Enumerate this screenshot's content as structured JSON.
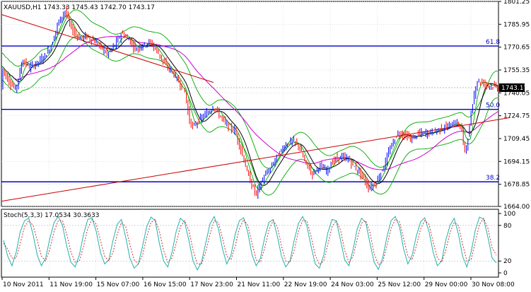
{
  "chart_data": [
    {
      "type": "candlestick",
      "header": "XAUUSD,H1  1743.33 1745.43 1742.70 1743.17",
      "y_ticks": [
        "1801.25",
        "1785.95",
        "1770.65",
        "1755.35",
        "1740.05",
        "1724.75",
        "1709.45",
        "1694.15",
        "1678.85",
        "1664.00"
      ],
      "ylim": [
        1664.0,
        1801.25
      ],
      "current_price": "1743.17",
      "colors": {
        "bull": "#0000ff",
        "bear": "#ff0000",
        "fib_line": "#0000cc",
        "trendline": "#cc0000",
        "bands": "#00aa00",
        "ma_slow": "#cc00cc",
        "ma_fast": "#000000",
        "grid": "#c8d0d8"
      },
      "fib_levels": [
        {
          "label": "61.8",
          "value": 1771.4
        },
        {
          "label": "50.0",
          "value": 1729.0
        },
        {
          "label": "38.2",
          "value": 1680.5
        }
      ],
      "trend_channel": {
        "upper": [
          [
            0,
            1792.5
          ],
          [
            300,
            1747.0
          ]
        ],
        "lower": [
          [
            0,
            1667.5
          ],
          [
            720,
            1723.5
          ]
        ]
      },
      "price_path": [
        [
          0,
          1758
        ],
        [
          10,
          1748
        ],
        [
          20,
          1742
        ],
        [
          30,
          1762
        ],
        [
          40,
          1757
        ],
        [
          50,
          1760
        ],
        [
          60,
          1764
        ],
        [
          70,
          1771
        ],
        [
          80,
          1787
        ],
        [
          90,
          1795
        ],
        [
          100,
          1782
        ],
        [
          110,
          1777
        ],
        [
          120,
          1778
        ],
        [
          130,
          1775
        ],
        [
          140,
          1771
        ],
        [
          150,
          1766
        ],
        [
          160,
          1772
        ],
        [
          170,
          1780
        ],
        [
          180,
          1776
        ],
        [
          190,
          1769
        ],
        [
          200,
          1772
        ],
        [
          210,
          1774
        ],
        [
          220,
          1768
        ],
        [
          230,
          1760
        ],
        [
          240,
          1755
        ],
        [
          250,
          1748
        ],
        [
          260,
          1740
        ],
        [
          265,
          1723
        ],
        [
          270,
          1717
        ],
        [
          280,
          1722
        ],
        [
          290,
          1726
        ],
        [
          300,
          1731
        ],
        [
          310,
          1724
        ],
        [
          320,
          1718
        ],
        [
          330,
          1715
        ],
        [
          340,
          1700
        ],
        [
          350,
          1683
        ],
        [
          360,
          1672
        ],
        [
          370,
          1683
        ],
        [
          380,
          1689
        ],
        [
          390,
          1698
        ],
        [
          400,
          1704
        ],
        [
          410,
          1708
        ],
        [
          420,
          1705
        ],
        [
          430,
          1693
        ],
        [
          440,
          1686
        ],
        [
          450,
          1691
        ],
        [
          460,
          1688
        ],
        [
          470,
          1695
        ],
        [
          480,
          1697
        ],
        [
          490,
          1696
        ],
        [
          500,
          1690
        ],
        [
          510,
          1685
        ],
        [
          520,
          1676
        ],
        [
          530,
          1680
        ],
        [
          540,
          1690
        ],
        [
          550,
          1703
        ],
        [
          560,
          1713
        ],
        [
          570,
          1712
        ],
        [
          580,
          1709
        ],
        [
          590,
          1713
        ],
        [
          600,
          1713
        ],
        [
          610,
          1714
        ],
        [
          620,
          1716
        ],
        [
          630,
          1717
        ],
        [
          640,
          1720
        ],
        [
          650,
          1718
        ],
        [
          655,
          1700
        ],
        [
          660,
          1710
        ],
        [
          665,
          1729
        ],
        [
          672,
          1748
        ],
        [
          680,
          1747
        ],
        [
          690,
          1745
        ],
        [
          700,
          1744
        ],
        [
          704,
          1743
        ]
      ]
    },
    {
      "type": "line",
      "header": "Stoch(5,3,3) 17.0534 30.3633",
      "y_ticks": [
        "100",
        "80",
        "20",
        "0"
      ],
      "ylim": [
        0,
        100
      ],
      "colors": {
        "main": "#20b2aa",
        "signal": "#cc3333"
      },
      "series": [
        {
          "values": [
            55,
            28,
            12,
            35,
            70,
            88,
            92,
            65,
            30,
            12,
            25,
            58,
            85,
            95,
            80,
            45,
            18,
            10,
            30,
            65,
            90,
            93,
            70,
            35,
            15,
            22,
            55,
            82,
            90,
            60,
            25,
            8,
            15,
            45,
            78,
            94,
            88,
            50,
            20,
            10,
            35,
            70,
            92,
            85,
            55,
            20,
            5,
            18,
            50,
            82,
            95,
            75,
            40,
            15,
            30,
            65,
            88,
            93,
            68,
            30,
            12,
            25,
            60,
            85,
            90,
            62,
            28,
            10,
            20,
            55,
            83,
            95,
            80,
            45,
            15,
            8,
            30,
            68,
            90,
            88,
            55,
            22,
            12,
            40,
            75,
            92,
            85,
            50,
            18,
            6,
            25,
            60,
            88,
            95,
            78,
            40,
            15,
            30,
            62,
            86,
            93,
            70,
            35,
            12,
            20,
            55,
            80,
            92,
            65,
            28,
            10,
            35,
            72,
            94,
            90,
            60,
            25,
            17
          ]
        },
        {
          "values": [
            50,
            40,
            25,
            25,
            50,
            78,
            88,
            80,
            55,
            28,
            20,
            40,
            70,
            88,
            88,
            65,
            35,
            18,
            20,
            45,
            75,
            90,
            82,
            55,
            28,
            20,
            35,
            65,
            85,
            78,
            48,
            22,
            15,
            30,
            60,
            85,
            90,
            70,
            38,
            18,
            25,
            50,
            78,
            88,
            72,
            38,
            15,
            15,
            35,
            65,
            88,
            85,
            58,
            28,
            22,
            45,
            75,
            90,
            80,
            50,
            22,
            18,
            42,
            72,
            88,
            78,
            45,
            20,
            18,
            38,
            70,
            88,
            88,
            62,
            30,
            14,
            20,
            48,
            78,
            88,
            72,
            38,
            18,
            28,
            58,
            84,
            88,
            68,
            32,
            14,
            18,
            45,
            75,
            90,
            86,
            58,
            28,
            22,
            45,
            74,
            88,
            82,
            52,
            25,
            18,
            38,
            68,
            85,
            80,
            48,
            20,
            22,
            52,
            82,
            92,
            75,
            42,
            30
          ]
        }
      ]
    }
  ],
  "x_ticks": [
    "10 Nov 2011",
    "11 Nov 19:00",
    "15 Nov 07:00",
    "16 Nov 15:00",
    "17 Nov 23:00",
    "21 Nov 11:00",
    "22 Nov 19:00",
    "24 Nov 03:00",
    "25 Nov 12:00",
    "29 Nov 00:00",
    "30 Nov 08:00"
  ]
}
